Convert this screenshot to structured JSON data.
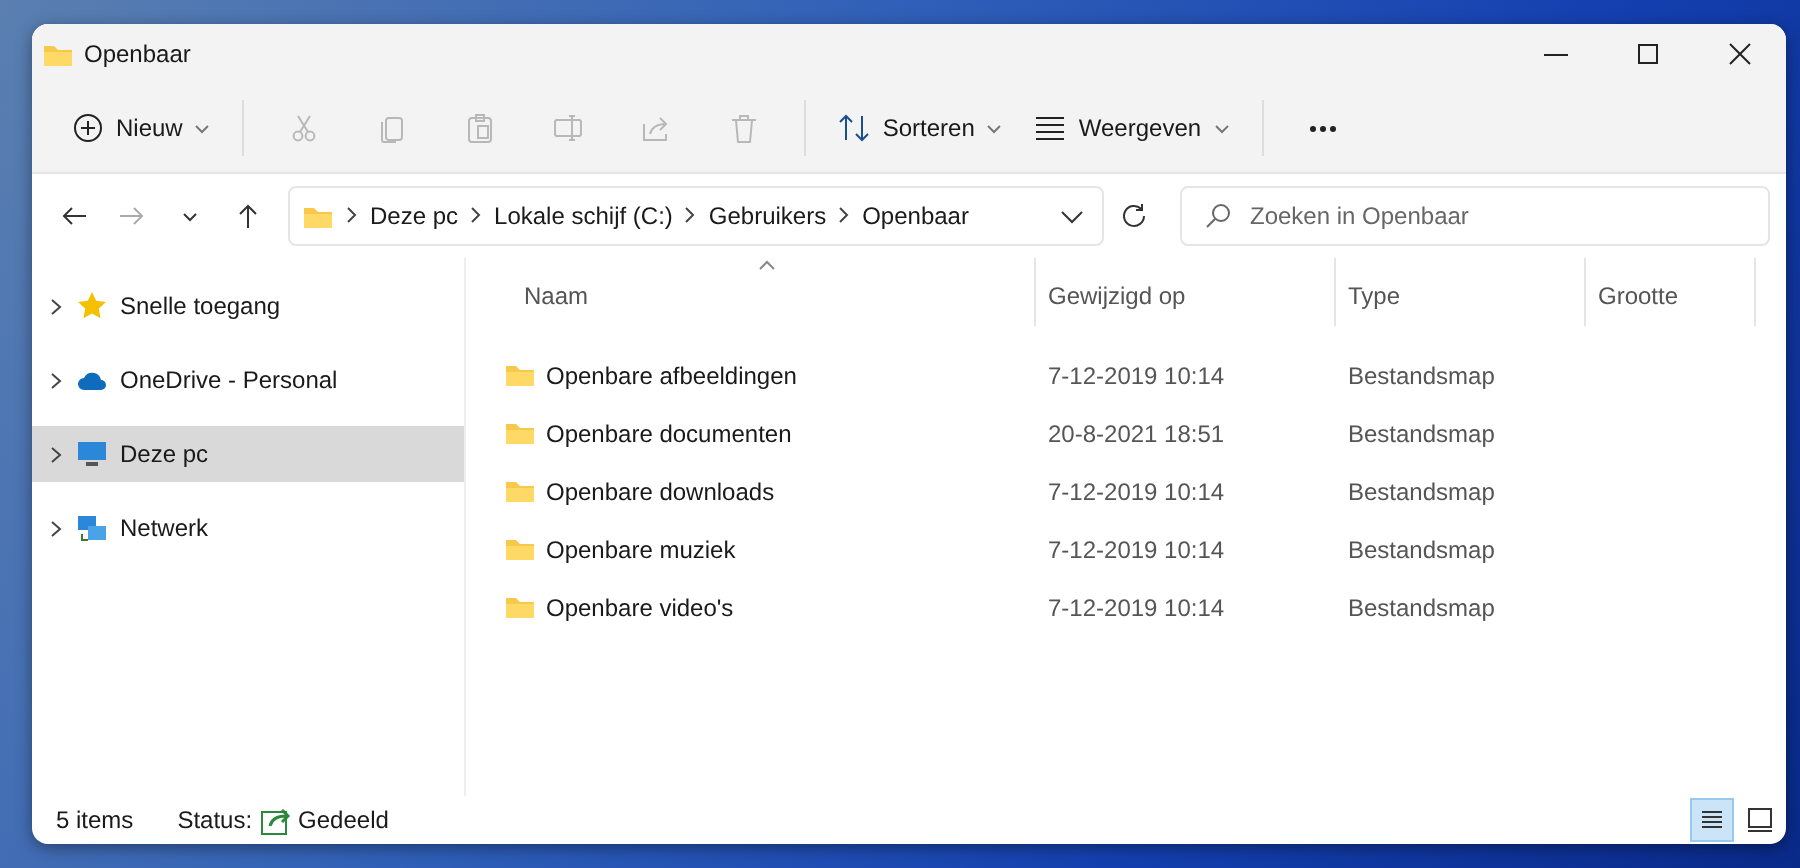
{
  "window": {
    "title": "Openbaar"
  },
  "toolbar": [
    {
      "kind": "new",
      "label": "Nieuw",
      "disabled": false
    },
    {
      "kind": "cut",
      "disabled": true
    },
    {
      "kind": "copy",
      "disabled": true
    },
    {
      "kind": "paste",
      "disabled": true
    },
    {
      "kind": "rename",
      "disabled": true
    },
    {
      "kind": "share",
      "disabled": true
    },
    {
      "kind": "delete",
      "disabled": true
    },
    {
      "kind": "sort",
      "label": "Sorteren",
      "disabled": false
    },
    {
      "kind": "view",
      "label": "Weergeven",
      "disabled": false
    },
    {
      "kind": "more",
      "disabled": false
    }
  ],
  "navigation": [
    {
      "kind": "back",
      "disabled": false
    },
    {
      "kind": "forward",
      "disabled": true
    },
    {
      "kind": "recent",
      "disabled": false
    },
    {
      "kind": "up",
      "disabled": false
    }
  ],
  "address": {
    "crumbs": [
      "Deze pc",
      "Lokale schijf (C:)",
      "Gebruikers",
      "Openbaar"
    ]
  },
  "search": {
    "placeholder": "Zoeken in Openbaar"
  },
  "sidebar": {
    "items": [
      {
        "kind": "star",
        "label": "Snelle toegang",
        "selected": false
      },
      {
        "kind": "cloud",
        "label": "OneDrive - Personal",
        "selected": false
      },
      {
        "kind": "pc",
        "label": "Deze pc",
        "selected": true
      },
      {
        "kind": "network",
        "label": "Netwerk",
        "selected": false
      }
    ]
  },
  "table": {
    "columns": [
      {
        "label": "Naam",
        "sorted": true
      },
      {
        "label": "Gewijzigd op",
        "sorted": false
      },
      {
        "label": "Type",
        "sorted": false
      },
      {
        "label": "Grootte",
        "sorted": false
      }
    ],
    "rows": [
      {
        "name": "Openbare afbeeldingen",
        "modified": "7-12-2019 10:14",
        "type": "Bestandsmap"
      },
      {
        "name": "Openbare documenten",
        "modified": "20-8-2021 18:51",
        "type": "Bestandsmap"
      },
      {
        "name": "Openbare downloads",
        "modified": "7-12-2019 10:14",
        "type": "Bestandsmap"
      },
      {
        "name": "Openbare muziek",
        "modified": "7-12-2019 10:14",
        "type": "Bestandsmap"
      },
      {
        "name": "Openbare video's",
        "modified": "7-12-2019 10:14",
        "type": "Bestandsmap"
      }
    ]
  },
  "status_bar": {
    "count": "5 items",
    "status_label": "Status:",
    "status": "Gedeeld",
    "views": [
      {
        "kind": "details",
        "selected": true
      },
      {
        "kind": "tiles",
        "selected": false
      }
    ]
  }
}
